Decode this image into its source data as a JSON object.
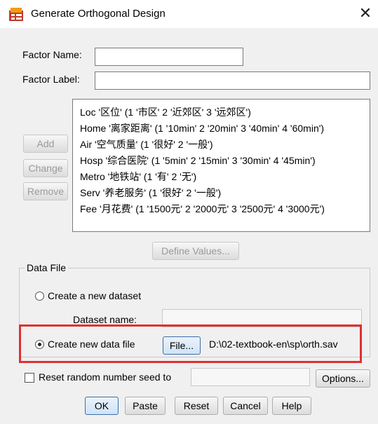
{
  "window": {
    "title": "Generate Orthogonal Design",
    "close_glyph": "✕",
    "app_icon": "spss-dataset-icon"
  },
  "factor": {
    "name_label": "Factor Name:",
    "name_value": "",
    "label_label": "Factor Label:",
    "label_value": ""
  },
  "side_buttons": {
    "add": "Add",
    "change": "Change",
    "remove": "Remove"
  },
  "factor_list": [
    "Loc '区位' (1 '市区' 2 '近郊区' 3 '远郊区')",
    "Home '离家距离' (1 '10min' 2 '20min' 3 '40min' 4 '60min')",
    "Air '空气质量' (1 '很好' 2 '一般')",
    "Hosp '综合医院' (1 '5min' 2 '15min' 3 '30min' 4 '45min')",
    "Metro '地铁站' (1 '有' 2 '无')",
    "Serv '养老服务' (1 '很好' 2 '一般')",
    "Fee '月花费' (1 '1500元' 2 '2000元' 3 '2500元' 4 '3000元')"
  ],
  "define_values_button": "Define Values...",
  "data_file": {
    "group_title": "Data File",
    "option_new_dataset": "Create a new dataset",
    "dataset_name_label": "Dataset name:",
    "dataset_name_value": "",
    "option_new_file": "Create new data file",
    "file_button": "File...",
    "file_path": "D:\\02-textbook-en\\sp\\orth.sav",
    "selected_option": "Create new data file"
  },
  "random_seed": {
    "label": "Reset random number seed to",
    "checked": false,
    "value": ""
  },
  "options_button": "Options...",
  "footer_buttons": {
    "ok": "OK",
    "paste": "Paste",
    "reset": "Reset",
    "cancel": "Cancel",
    "help": "Help"
  },
  "colors": {
    "highlight": "#e03030",
    "dialog_bg": "#f0f0f0",
    "primary_border": "#3a6ea5"
  }
}
